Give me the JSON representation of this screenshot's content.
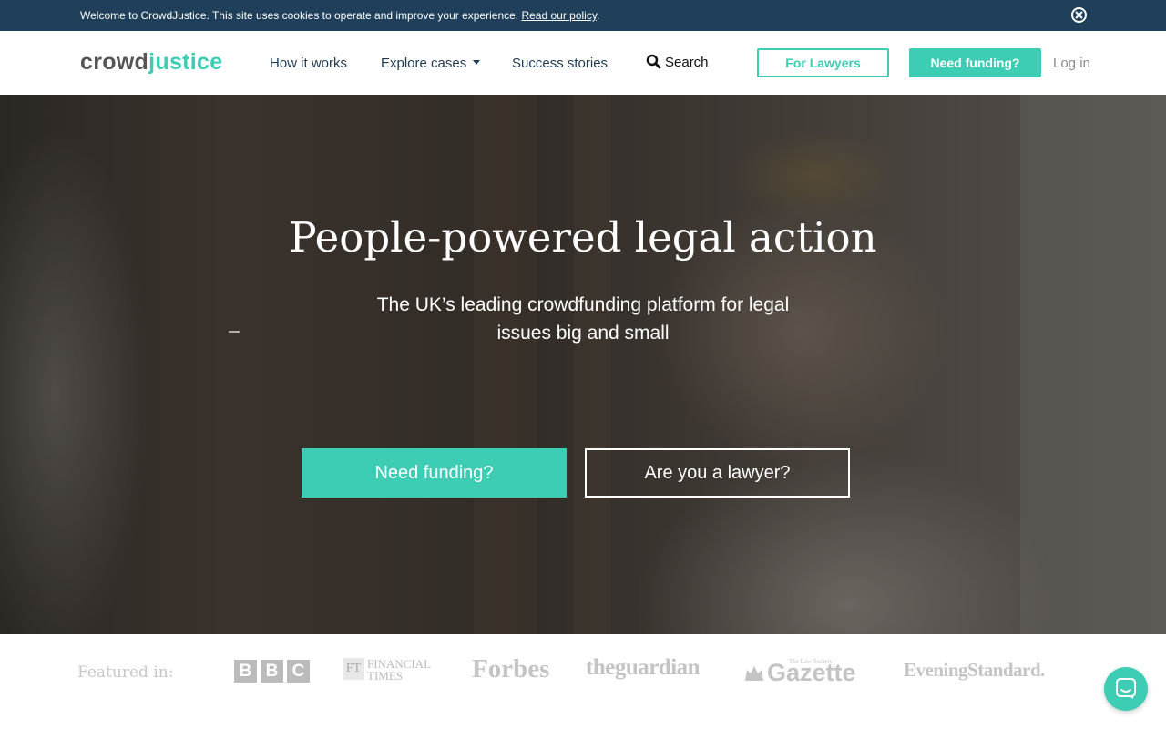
{
  "cookie_banner": {
    "text": "Welcome to CrowdJustice. This site uses cookies to operate and improve your experience.",
    "link": "Read our policy",
    "suffix": ".",
    "close_icon": "close-circle-icon"
  },
  "header": {
    "logo_part1": "crowd",
    "logo_part2": "justice",
    "nav": {
      "how_it_works": "How it works",
      "explore_cases": "Explore cases",
      "success_stories": "Success stories",
      "search": "Search"
    },
    "for_lawyers": "For Lawyers",
    "need_funding": "Need funding?",
    "login": "Log in"
  },
  "hero": {
    "title": "People-powered legal action",
    "subtitle": "The UK’s leading crowdfunding platform for legal issues big and small",
    "cta_primary": "Need funding?",
    "cta_secondary": "Are you a lawyer?"
  },
  "featured": {
    "label": "Featured in:",
    "bbc": [
      "B",
      "B",
      "C"
    ],
    "ft_box": "FT",
    "ft_line1": "FINANCIAL",
    "ft_line2": "TIMES",
    "forbes": "Forbes",
    "guardian": "theguardian",
    "gazette_small": "The Law Society",
    "gazette": "Gazette",
    "standard": "EveningStandard."
  },
  "colors": {
    "accent": "#3dccb4",
    "banner": "#1f3f5a",
    "nav_text": "#1f3b52"
  },
  "chat_icon": "chat-icon"
}
